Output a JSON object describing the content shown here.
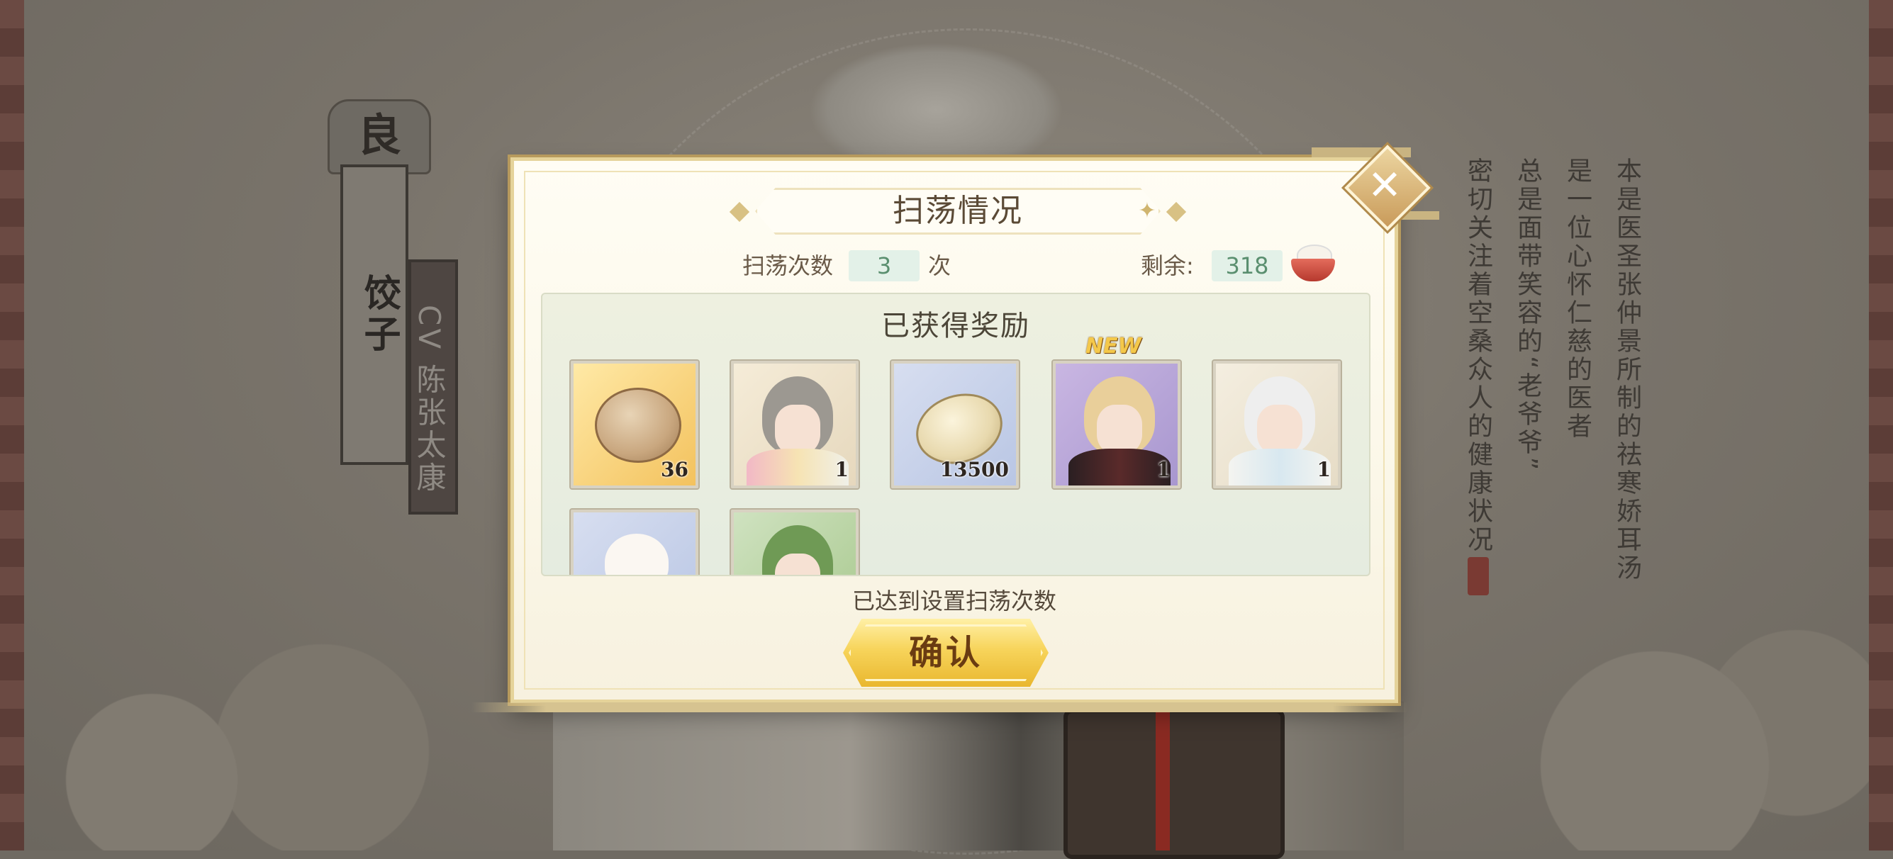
{
  "background": {
    "character_badge": "良",
    "character_name": "饺子",
    "cv_label": "CV 陈张太康",
    "description_lines": [
      "本是医圣张仲景所制的祛寒娇耳汤",
      "是一位心怀仁慈的医者",
      "总是面带笑容的“老爷爷”",
      "密切关注着空桑众人的健康状况"
    ]
  },
  "dialog": {
    "title": "扫荡情况",
    "sweep_count_label": "扫荡次数",
    "sweep_count_value": "3",
    "sweep_count_unit": "次",
    "remaining_label": "剩余:",
    "remaining_value": "318",
    "remaining_icon": "rice-bowl-icon",
    "rewards_title": "已获得奖励",
    "rewards": [
      {
        "icon": "coin-icon",
        "count": "36",
        "new": false
      },
      {
        "icon": "girl-portrait-icon",
        "count": "1",
        "new": false
      },
      {
        "icon": "shell-icon",
        "count": "13500",
        "new": false
      },
      {
        "icon": "blonde-portrait-icon",
        "count": "1",
        "new": true,
        "new_label": "NEW"
      },
      {
        "icon": "white-hair-portrait-icon",
        "count": "1",
        "new": false
      },
      {
        "icon": "pet-icon",
        "count": "",
        "new": false
      },
      {
        "icon": "green-hair-portrait-icon",
        "count": "",
        "new": false
      }
    ],
    "status_text": "已达到设置扫荡次数",
    "confirm_label": "确认",
    "close_icon": "close-icon"
  },
  "colors": {
    "accent_gold": "#f7d45b",
    "count_green": "#5a8f6f",
    "frame_gold": "#e5d39a"
  }
}
